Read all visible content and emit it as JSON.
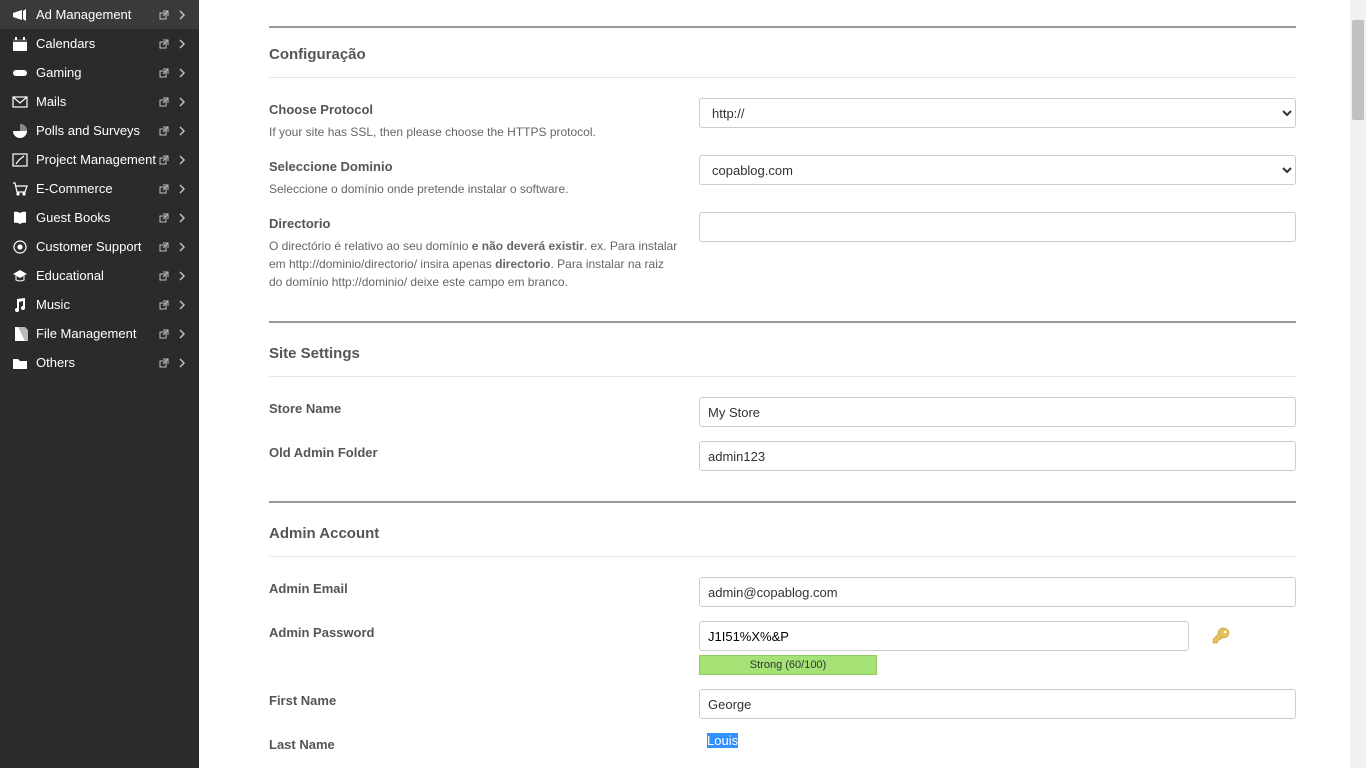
{
  "sidebar": {
    "items": [
      {
        "label": "Ad Management",
        "icon": "megaphone"
      },
      {
        "label": "Calendars",
        "icon": "calendar"
      },
      {
        "label": "Gaming",
        "icon": "gamepad"
      },
      {
        "label": "Mails",
        "icon": "mail"
      },
      {
        "label": "Polls and Surveys",
        "icon": "pie"
      },
      {
        "label": "Project Management",
        "icon": "project"
      },
      {
        "label": "E-Commerce",
        "icon": "cart"
      },
      {
        "label": "Guest Books",
        "icon": "book"
      },
      {
        "label": "Customer Support",
        "icon": "support"
      },
      {
        "label": "Educational",
        "icon": "grad"
      },
      {
        "label": "Music",
        "icon": "music"
      },
      {
        "label": "File Management",
        "icon": "file"
      },
      {
        "label": "Others",
        "icon": "folder"
      }
    ]
  },
  "sections": {
    "config": {
      "title": "Configuração",
      "protocol_label": "Choose Protocol",
      "protocol_help": "If your site has SSL, then please choose the HTTPS protocol.",
      "protocol_value": "http://",
      "domain_label": "Seleccione Dominio",
      "domain_help": "Seleccione o domínio onde pretende instalar o software.",
      "domain_value": "copablog.com",
      "dir_label": "Directorio",
      "dir_help_a": "O directório é relativo ao seu domínio ",
      "dir_help_b": "e não deverá existir",
      "dir_help_c": ". ex. Para instalar em http://dominio/directorio/ insira apenas ",
      "dir_help_d": "directorio",
      "dir_help_e": ". Para instalar na raiz do domínio http://dominio/ deixe este campo em branco.",
      "dir_value": ""
    },
    "site": {
      "title": "Site Settings",
      "store_label": "Store Name",
      "store_value": "My Store",
      "admin_folder_label": "Old Admin Folder",
      "admin_folder_value": "admin123"
    },
    "admin": {
      "title": "Admin Account",
      "email_label": "Admin Email",
      "email_value": "admin@copablog.com",
      "pw_label": "Admin Password",
      "pw_value": "J1I51%X%&P",
      "pw_strength": "Strong (60/100)",
      "fn_label": "First Name",
      "fn_value": "George",
      "ln_label": "Last Name",
      "ln_value": "Louis"
    }
  }
}
